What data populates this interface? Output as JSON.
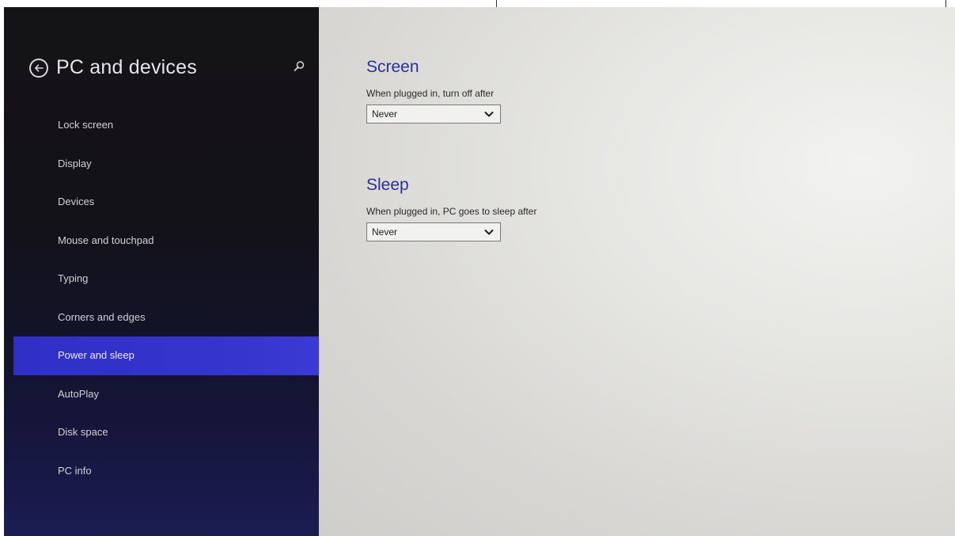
{
  "nav": {
    "title": "PC and devices",
    "back_icon": "back-arrow-icon",
    "search_icon": "search-icon",
    "items": [
      {
        "label": "Lock screen"
      },
      {
        "label": "Display"
      },
      {
        "label": "Devices"
      },
      {
        "label": "Mouse and touchpad"
      },
      {
        "label": "Typing"
      },
      {
        "label": "Corners and edges"
      },
      {
        "label": "Power and sleep"
      },
      {
        "label": "AutoPlay"
      },
      {
        "label": "Disk space"
      },
      {
        "label": "PC info"
      }
    ],
    "selected_item": "Power and sleep"
  },
  "content": {
    "screen": {
      "title": "Screen",
      "label": "When plugged in, turn off after",
      "value": "Never"
    },
    "sleep": {
      "title": "Sleep",
      "label": "When plugged in, PC goes to sleep after",
      "value": "Never"
    }
  },
  "colors": {
    "accent": "#3434cc",
    "section_title": "#2c2f9a",
    "nav_background": "#141316",
    "content_background": "#e6e6e3"
  }
}
